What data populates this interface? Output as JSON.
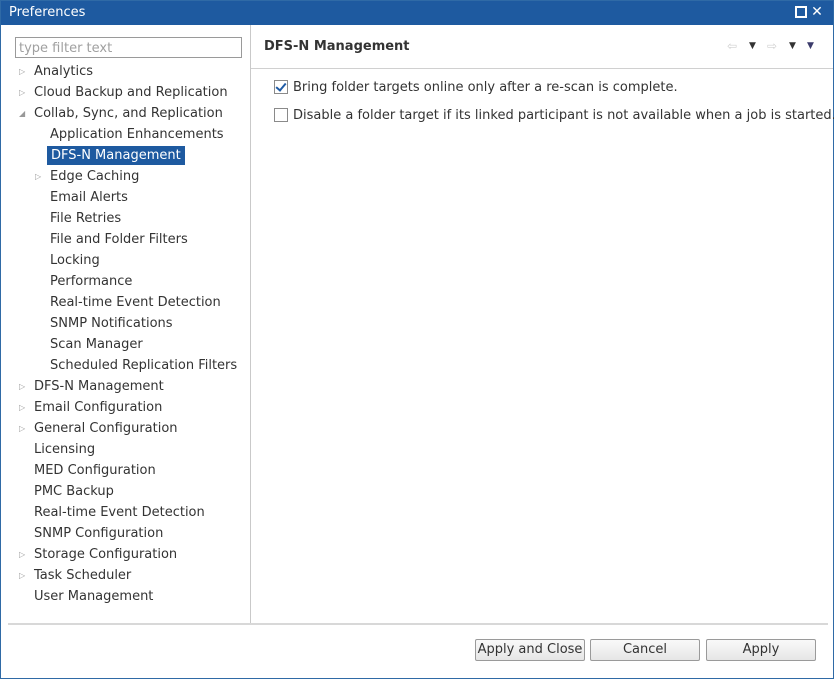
{
  "window": {
    "title": "Preferences"
  },
  "filter": {
    "placeholder": "type filter text"
  },
  "tree": [
    {
      "label": "Analytics",
      "level": 0,
      "arrow": "collapsed"
    },
    {
      "label": "Cloud Backup and Replication",
      "level": 0,
      "arrow": "collapsed"
    },
    {
      "label": "Collab, Sync, and Replication",
      "level": 0,
      "arrow": "expanded"
    },
    {
      "label": "Application Enhancements",
      "level": 1,
      "arrow": "none"
    },
    {
      "label": "DFS-N Management",
      "level": 1,
      "arrow": "none",
      "selected": true
    },
    {
      "label": "Edge Caching",
      "level": 1,
      "arrow": "collapsed"
    },
    {
      "label": "Email Alerts",
      "level": 1,
      "arrow": "none"
    },
    {
      "label": "File Retries",
      "level": 1,
      "arrow": "none"
    },
    {
      "label": "File and Folder Filters",
      "level": 1,
      "arrow": "none"
    },
    {
      "label": "Locking",
      "level": 1,
      "arrow": "none"
    },
    {
      "label": "Performance",
      "level": 1,
      "arrow": "none"
    },
    {
      "label": "Real-time Event Detection",
      "level": 1,
      "arrow": "none"
    },
    {
      "label": "SNMP Notifications",
      "level": 1,
      "arrow": "none"
    },
    {
      "label": "Scan Manager",
      "level": 1,
      "arrow": "none"
    },
    {
      "label": "Scheduled Replication Filters",
      "level": 1,
      "arrow": "none"
    },
    {
      "label": "DFS-N Management",
      "level": 0,
      "arrow": "collapsed"
    },
    {
      "label": "Email Configuration",
      "level": 0,
      "arrow": "collapsed"
    },
    {
      "label": "General Configuration",
      "level": 0,
      "arrow": "collapsed"
    },
    {
      "label": "Licensing",
      "level": 0,
      "arrow": "none"
    },
    {
      "label": "MED Configuration",
      "level": 0,
      "arrow": "none"
    },
    {
      "label": "PMC Backup",
      "level": 0,
      "arrow": "none"
    },
    {
      "label": "Real-time Event Detection",
      "level": 0,
      "arrow": "none"
    },
    {
      "label": "SNMP Configuration",
      "level": 0,
      "arrow": "none"
    },
    {
      "label": "Storage Configuration",
      "level": 0,
      "arrow": "collapsed"
    },
    {
      "label": "Task Scheduler",
      "level": 0,
      "arrow": "collapsed"
    },
    {
      "label": "User Management",
      "level": 0,
      "arrow": "none"
    }
  ],
  "page": {
    "title": "DFS-N Management",
    "options": [
      {
        "label": "Bring folder targets online only after a re-scan is complete.",
        "checked": true
      },
      {
        "label": "Disable a folder target if its linked participant is not available when a job is started.",
        "checked": false
      }
    ]
  },
  "buttons": {
    "apply_close": "Apply and Close",
    "cancel": "Cancel",
    "apply": "Apply"
  },
  "colors": {
    "titlebar": "#1e5aa0",
    "selection": "#1e5aa0"
  }
}
